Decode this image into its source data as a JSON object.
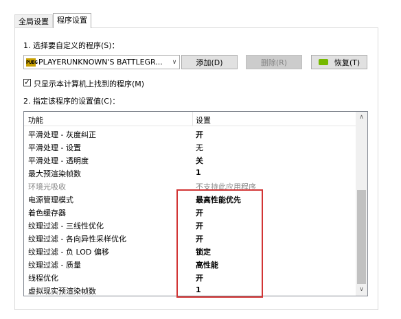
{
  "tabs": [
    {
      "label": "全局设置",
      "active": false
    },
    {
      "label": "程序设置",
      "active": true
    }
  ],
  "step1_label": "1. 选择要自定义的程序(S)：",
  "program_combo": {
    "icon": "game-icon",
    "value": "PLAYERUNKNOWN'S BATTLEGR..."
  },
  "buttons": {
    "add": "添加(D)",
    "remove": "删除(R)",
    "restore": "恢复(T)"
  },
  "checkbox": {
    "checked": true,
    "label": "只显示本计算机上找到的程序(M)"
  },
  "step2_label": "2. 指定该程序的设置值(C)：",
  "table": {
    "col_feature": "功能",
    "col_setting": "设置",
    "rows": [
      {
        "feature": "平滑处理 - 灰度纠正",
        "setting": "开",
        "bold": true
      },
      {
        "feature": "平滑处理 - 设置",
        "setting": "无",
        "bold": false
      },
      {
        "feature": "平滑处理 - 透明度",
        "setting": "关",
        "bold": true
      },
      {
        "feature": "最大预渲染帧数",
        "setting": "1",
        "bold": true
      },
      {
        "feature": "环境光吸收",
        "setting": "不支持此应用程序",
        "bold": false,
        "disabled": true
      },
      {
        "feature": "电源管理模式",
        "setting": "最高性能优先",
        "bold": true
      },
      {
        "feature": "着色缓存器",
        "setting": "开",
        "bold": true
      },
      {
        "feature": "纹理过滤 - 三线性优化",
        "setting": "开",
        "bold": true
      },
      {
        "feature": "纹理过滤 - 各向异性采样优化",
        "setting": "开",
        "bold": true
      },
      {
        "feature": "纹理过滤 - 负 LOD 偏移",
        "setting": "锁定",
        "bold": true
      },
      {
        "feature": "纹理过滤 - 质量",
        "setting": "高性能",
        "bold": true
      },
      {
        "feature": "线程优化",
        "setting": "开",
        "bold": true
      },
      {
        "feature": "虚拟现实预渲染帧数",
        "setting": "1",
        "bold": true
      }
    ]
  },
  "colors": {
    "highlight_box": "#d23434",
    "nvidia_green": "#76b900"
  }
}
